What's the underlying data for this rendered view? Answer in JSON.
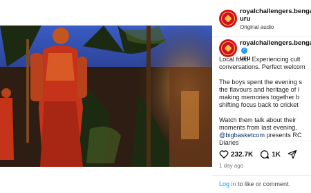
{
  "post": {
    "username_line1": "royalchallengers.bengal",
    "username_line2": "uru",
    "audio_label": "Original audio",
    "caption_lines": [
      "Local food. Experiencing cult",
      "conversations. Perfect welcom"
    ],
    "caption_para2": [
      "The boys spent the evening s",
      "the flavours and heritage of I",
      "making memories together b",
      "shifting focus back to cricket"
    ],
    "caption_para3": [
      "Watch them talk about their",
      "moments from last evening, "
    ],
    "caption_tag": "@bigbasketcom",
    "caption_tag_suffix": " presents RC",
    "caption_last": "Diaries",
    "likes": "232.7K",
    "comments": "1K",
    "time_ago": "1 day ago",
    "login_link": "Log in",
    "login_suffix": " to like or comment."
  },
  "icons": {
    "heart": "heart-icon",
    "comment": "comment-icon",
    "share": "share-icon",
    "mute": "mute-icon",
    "verified": "verified-badge-icon"
  },
  "colors": {
    "brand_red": "#d20f1f",
    "brand_gold": "#f3c24a",
    "verified_blue": "#1d9bf0",
    "link_blue": "#0095f6",
    "tag_blue": "#00376b"
  }
}
